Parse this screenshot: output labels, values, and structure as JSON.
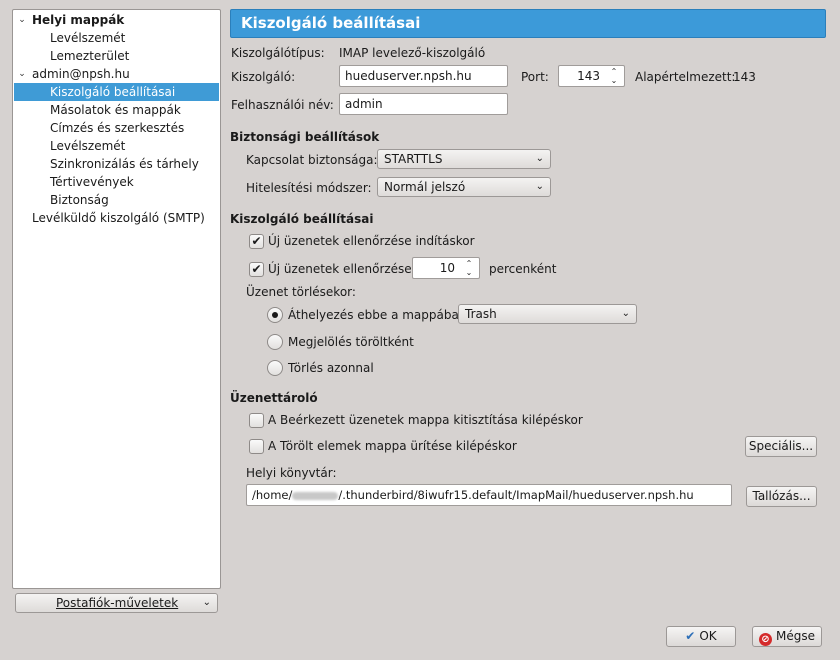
{
  "tree": {
    "local_folders": {
      "label": "Helyi mappák",
      "children": [
        "Levélszemét",
        "Lemezterület"
      ]
    },
    "account": {
      "label": "admin@npsh.hu",
      "children": [
        "Kiszolgáló beállításai",
        "Másolatok és mappák",
        "Címzés és szerkesztés",
        "Levélszemét",
        "Szinkronizálás és tárhely",
        "Tértivevények",
        "Biztonság"
      ],
      "selected_index": 0
    },
    "smtp": "Levélküldő kiszolgáló (SMTP)"
  },
  "account_actions_label": "Postafiók-műveletek",
  "page_title": "Kiszolgáló beállításai",
  "server": {
    "type_label": "Kiszolgálótípus:",
    "type_value": "IMAP levelező-kiszolgáló",
    "host_label": "Kiszolgáló:",
    "host_value": "hueduserver.npsh.hu",
    "port_label": "Port:",
    "port_value": "143",
    "default_label": "Alapértelmezett:",
    "default_value": "143",
    "user_label": "Felhasználói név:",
    "user_value": "admin"
  },
  "security": {
    "heading": "Biztonsági beállítások",
    "conn_label": "Kapcsolat biztonsága:",
    "conn_value": "STARTTLS",
    "auth_label": "Hitelesítési módszer:",
    "auth_value": "Normál jelszó"
  },
  "server_settings": {
    "heading": "Kiszolgáló beállításai",
    "check_on_startup": "Új üzenetek ellenőrzése indításkor",
    "check_every": "Új üzenetek ellenőrzése",
    "check_interval": "10",
    "per_minutes": "percenként",
    "on_delete_label": "Üzenet törlésekor:",
    "move_to": "Áthelyezés ebbe a mappába:",
    "move_target": "Trash",
    "mark_deleted": "Megjelölés töröltként",
    "delete_immediately": "Törlés azonnal"
  },
  "storage": {
    "heading": "Üzenettároló",
    "clean_inbox": "A Beérkezett üzenetek mappa kitisztítása kilépéskor",
    "empty_trash": "A Törölt elemek mappa ürítése kilépéskor",
    "advanced_button": "Speciális...",
    "local_dir_label": "Helyi könyvtár:",
    "local_dir_prefix": "/home/",
    "local_dir_suffix": "/.thunderbird/8iwufr15.default/ImapMail/hueduserver.npsh.hu",
    "browse_button": "Tallózás..."
  },
  "buttons": {
    "ok": "OK",
    "cancel": "Mégse"
  },
  "colors": {
    "header_bg": "#3c9ad9",
    "selection_bg": "#3f9bd6"
  }
}
